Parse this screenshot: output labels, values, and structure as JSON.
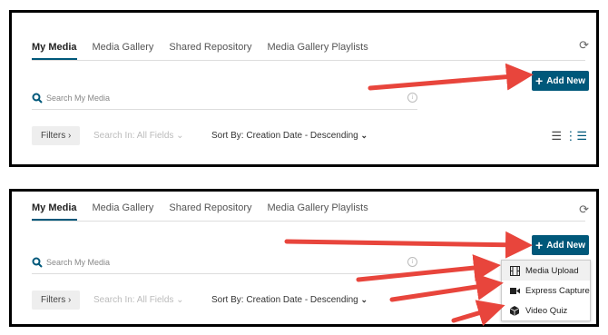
{
  "colors": {
    "accent": "#00587a",
    "arrow": "#e8453c"
  },
  "tabs": [
    {
      "label": "My Media",
      "active": true
    },
    {
      "label": "Media Gallery"
    },
    {
      "label": "Shared Repository"
    },
    {
      "label": "Media Gallery Playlists"
    }
  ],
  "add_new_label": "Add New",
  "search": {
    "placeholder": "Search My Media"
  },
  "filters_label": "Filters ›",
  "search_in_label": "Search In: All Fields ⌄",
  "sort_by_label": "Sort By: Creation Date - Descending",
  "add_menu": [
    {
      "label": "Media Upload",
      "icon": "film-icon"
    },
    {
      "label": "Express Capture",
      "icon": "video-camera-icon"
    },
    {
      "label": "Video Quiz",
      "icon": "cube-icon"
    }
  ]
}
